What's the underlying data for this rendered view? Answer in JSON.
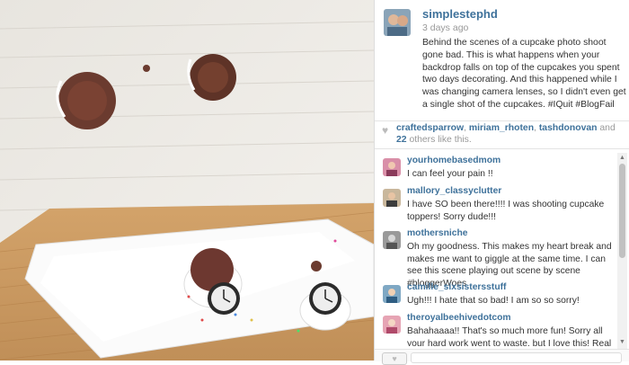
{
  "post": {
    "username": "simplestephd",
    "time": "3 days ago",
    "caption": "Behind the scenes of a cupcake photo shoot gone bad. This is what happens when your backdrop falls on top of the cupcakes you spent two days decorating. And this happened while I was changing camera lenses, so I didn't even get a single shot of the cupcakes. #IQuit #BlogFail"
  },
  "likes": {
    "users": [
      "craftedsparrow",
      "miriam_rhoten",
      "tashdonovan"
    ],
    "sep1": ", ",
    "sep2": " and ",
    "count": "22",
    "suffix": " others like this."
  },
  "comments": [
    {
      "username": "yourhomebasedmom",
      "text": "I can feel your pain !!"
    },
    {
      "username": "mallory_classyclutter",
      "text": "I have SO been there!!!! I was shooting cupcake toppers! Sorry dude!!!"
    },
    {
      "username": "mothersniche",
      "text": "Oh my goodness. This makes my heart break and makes me want to giggle at the same time. I can see this scene playing out scene by scene #bloggerWoes"
    },
    {
      "username": "camille_sixsistersstuff",
      "text": "Ugh!!! I hate that so bad! I am so so sorry!"
    },
    {
      "username": "theroyalbeehivedotcom",
      "text": "Bahahaaaa!! That's so much more fun! Sorry all your hard work went to waste, but I love this! Real life is"
    }
  ],
  "colors": {
    "link": "#3f729b"
  }
}
